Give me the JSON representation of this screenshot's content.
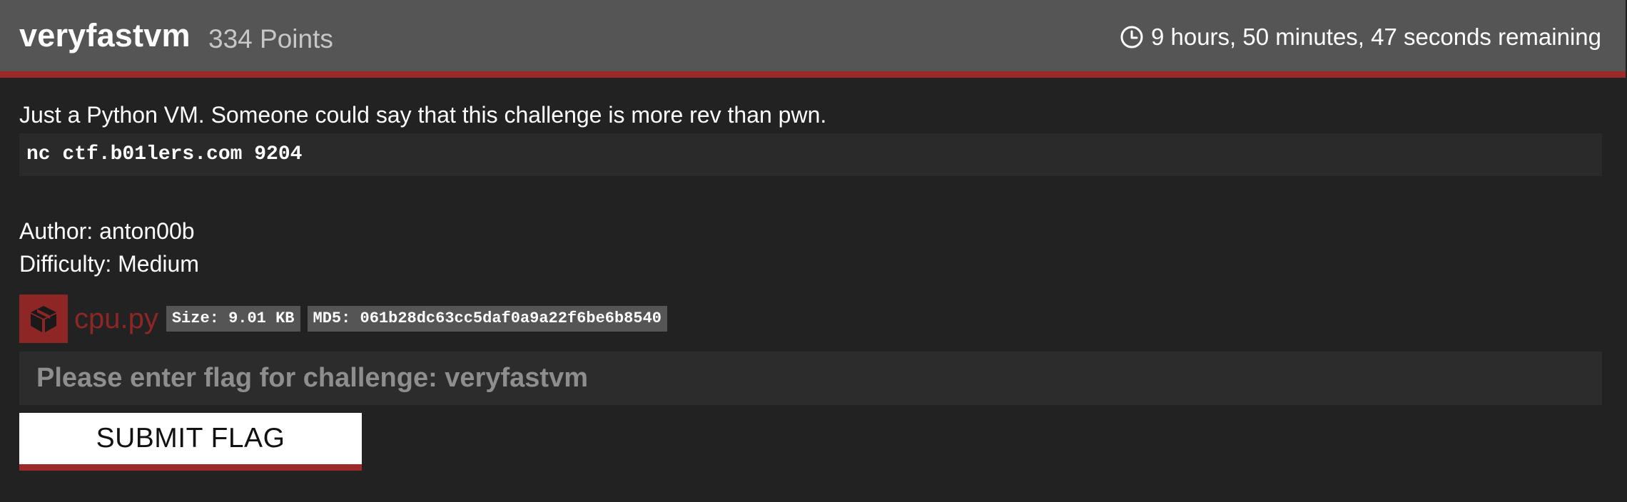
{
  "challenge": {
    "name": "veryfastvm",
    "points": "334 Points",
    "time_remaining": "9 hours, 50 minutes, 47 seconds remaining",
    "description": "Just a Python VM. Someone could say that this challenge is more rev than pwn.",
    "connection": "nc ctf.b01lers.com 9204",
    "author": "Author: anton00b",
    "difficulty": "Difficulty: Medium"
  },
  "file": {
    "name": "cpu.py",
    "size": "Size: 9.01 KB",
    "md5": "MD5: 061b28dc63cc5daf0a9a22f6be6b8540",
    "icon": "box-icon"
  },
  "flag_form": {
    "placeholder": "Please enter flag for challenge: veryfastvm",
    "value": "",
    "submit_label": "SUBMIT FLAG"
  },
  "colors": {
    "accent": "#9c2a2a",
    "header_bg": "#555555",
    "page_bg": "#222222"
  }
}
